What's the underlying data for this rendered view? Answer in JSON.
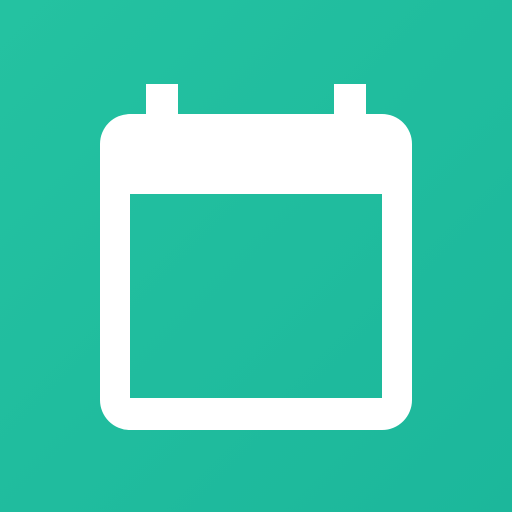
{
  "icon": {
    "name": "calendar-icon",
    "background_color": "#1fbc9f",
    "foreground_color": "#ffffff"
  }
}
